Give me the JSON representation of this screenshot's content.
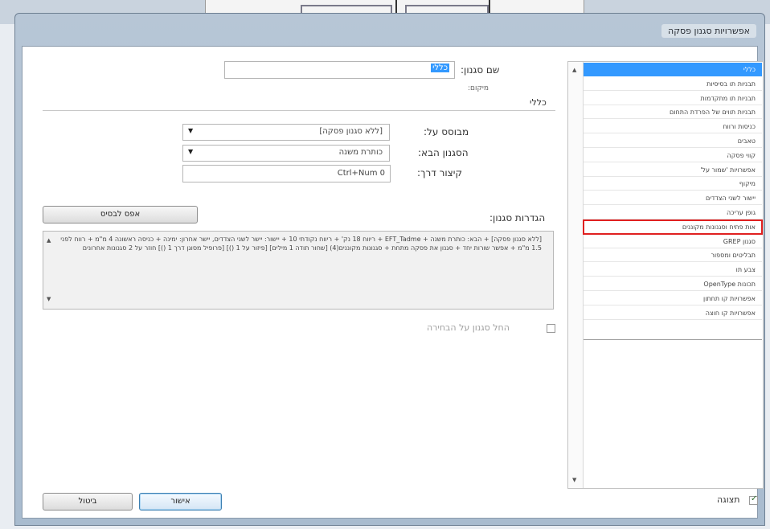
{
  "dialog": {
    "title": "אפשרויות סגנון פסקה"
  },
  "general": {
    "style_name_label": "שם סגנון:",
    "style_name_value": "כללי",
    "location_label": "מיקום:",
    "section_title": "כללי"
  },
  "based_on": {
    "label": "מבוסס על:",
    "value": "[ללא סגנון פסקה]"
  },
  "next_style": {
    "label": "הסגנון הבא:",
    "value": "כותרת משנה"
  },
  "shortcut": {
    "label": "קיצור דרך:",
    "value": "Ctrl+Num 0"
  },
  "style_settings": {
    "label": "הגדרות סגנון:",
    "reset_button": "אפס לבסיס",
    "description": "[ללא סגנון פסקה] + הבא: כותרת משנה + EFT_Tadme + ריווח 18 נק' + ריווח נקודתי 10 + יישור: יישר לשני הצדדים, יישר אחרון: ימינה + כניסה ראשונה 4 מ\"מ + רווח לפני 1.5 מ\"מ + אפשר שורות יחד + סגנון את פסקה מתחת + סגנונות מקוננים(4) [שחור תודה 1 מילים] [פיזור על 1 ()] [פרופיל מסוגן דרך 1 ()] חוזר על 2 סגנונות אחרונים"
  },
  "apply_checkbox": {
    "label": "החל סגנון על הבחירה",
    "checked": false
  },
  "preview": {
    "label": "תצוגה",
    "checked": true
  },
  "buttons": {
    "ok": "אישור",
    "cancel": "ביטול"
  },
  "categories": [
    {
      "label": "כללי"
    },
    {
      "label": "תבניות תו בסיסיות"
    },
    {
      "label": "תבניות תו מתקדמות"
    },
    {
      "label": "תבניות תווים של הפרדת התחום"
    },
    {
      "label": "כניסות ורווח"
    },
    {
      "label": "טאבים"
    },
    {
      "label": "קווי פסקה"
    },
    {
      "label": "אפשרויות 'שמור על'"
    },
    {
      "label": "מיקוף"
    },
    {
      "label": "יישור לשני הצדדים"
    },
    {
      "label": "גופן עריכה"
    },
    {
      "label": "אות פתיח וסגנונות מקוננים"
    },
    {
      "label": "סגנון GREP"
    },
    {
      "label": "תבליטים ומספור"
    },
    {
      "label": "צבע תו"
    },
    {
      "label": "תכונות OpenType"
    },
    {
      "label": "אפשרויות קו תחתון"
    },
    {
      "label": "אפשרויות קו חוצה"
    }
  ],
  "colors": {
    "selection": "#3399ff",
    "highlight_border": "#e02020"
  }
}
